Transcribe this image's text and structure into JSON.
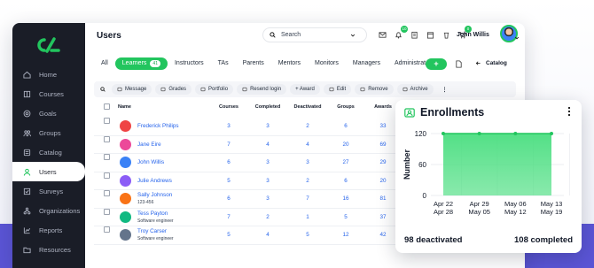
{
  "colors": {
    "accent": "#22c55e",
    "sidebar": "#1a1d27",
    "link": "#2563eb",
    "band": "#5b55d6"
  },
  "sidebar": {
    "items": [
      {
        "label": "Home",
        "icon": "home-icon"
      },
      {
        "label": "Courses",
        "icon": "book-icon"
      },
      {
        "label": "Goals",
        "icon": "target-icon"
      },
      {
        "label": "Groups",
        "icon": "groups-icon"
      },
      {
        "label": "Catalog",
        "icon": "catalog-icon"
      },
      {
        "label": "Users",
        "icon": "user-icon",
        "active": true
      },
      {
        "label": "Surveys",
        "icon": "survey-icon"
      },
      {
        "label": "Organizations",
        "icon": "org-icon"
      },
      {
        "label": "Reports",
        "icon": "chart-icon"
      },
      {
        "label": "Resources",
        "icon": "folder-icon"
      }
    ]
  },
  "header": {
    "title": "Users",
    "search_placeholder": "Search",
    "user_name": "John Willis",
    "badges": {
      "notifications": "10",
      "cart": "0"
    }
  },
  "tabs": [
    {
      "label": "All"
    },
    {
      "label": "Learners",
      "count": "41",
      "active": true
    },
    {
      "label": "Instructors"
    },
    {
      "label": "TAs"
    },
    {
      "label": "Parents"
    },
    {
      "label": "Mentors"
    },
    {
      "label": "Monitors"
    },
    {
      "label": "Managers"
    },
    {
      "label": "Administrators"
    }
  ],
  "toolbar": {
    "add_label": "+",
    "catalog_label": "Catalog"
  },
  "actions": [
    "Message",
    "Grades",
    "Portfolio",
    "Resend login",
    "+ Award",
    "Edit",
    "Remove",
    "Archive"
  ],
  "table": {
    "columns": [
      "Name",
      "Courses",
      "Completed",
      "Deactivated",
      "Groups",
      "Awards"
    ],
    "rows": [
      {
        "name": "Frederick Philips",
        "sub": "",
        "courses": "3",
        "completed": "3",
        "deactivated": "2",
        "groups": "6",
        "awards": "33",
        "avatar": "#ef4444"
      },
      {
        "name": "Jane Eire",
        "sub": "",
        "courses": "7",
        "completed": "4",
        "deactivated": "4",
        "groups": "20",
        "awards": "69",
        "avatar": "#ec4899"
      },
      {
        "name": "John Willis",
        "sub": "",
        "courses": "6",
        "completed": "3",
        "deactivated": "3",
        "groups": "27",
        "awards": "29",
        "avatar": "#3b82f6"
      },
      {
        "name": "Julie Andrews",
        "sub": "",
        "courses": "5",
        "completed": "3",
        "deactivated": "2",
        "groups": "6",
        "awards": "20",
        "avatar": "#8b5cf6"
      },
      {
        "name": "Sally Johnson",
        "sub": "123-456",
        "courses": "6",
        "completed": "3",
        "deactivated": "7",
        "groups": "16",
        "awards": "81",
        "avatar": "#f97316"
      },
      {
        "name": "Tess Payton",
        "sub": "Software engineer",
        "courses": "7",
        "completed": "2",
        "deactivated": "1",
        "groups": "5",
        "awards": "37",
        "avatar": "#10b981"
      },
      {
        "name": "Troy Carser",
        "sub": "Software engineer",
        "courses": "5",
        "completed": "4",
        "deactivated": "5",
        "groups": "12",
        "awards": "42",
        "avatar": "#64748b"
      }
    ]
  },
  "enrollments": {
    "title": "Enrollments",
    "deactivated_label": "98 deactivated",
    "completed_label": "108 completed"
  },
  "chart_data": {
    "type": "area",
    "title": "Enrollments",
    "ylabel": "Number",
    "categories": [
      "Apr 22\nApr 28",
      "Apr 29\nMay 05",
      "May 06\nMay 12",
      "May 13\nMay 19"
    ],
    "x_labels_top": [
      "Apr 22",
      "Apr 29",
      "May 06",
      "May 13"
    ],
    "x_labels_bottom": [
      "Apr 28",
      "May 05",
      "May 12",
      "May 19"
    ],
    "values": [
      120,
      120,
      120,
      120
    ],
    "yticks": [
      0,
      60,
      120
    ],
    "ylim": [
      0,
      120
    ],
    "color": "#4ade80"
  }
}
